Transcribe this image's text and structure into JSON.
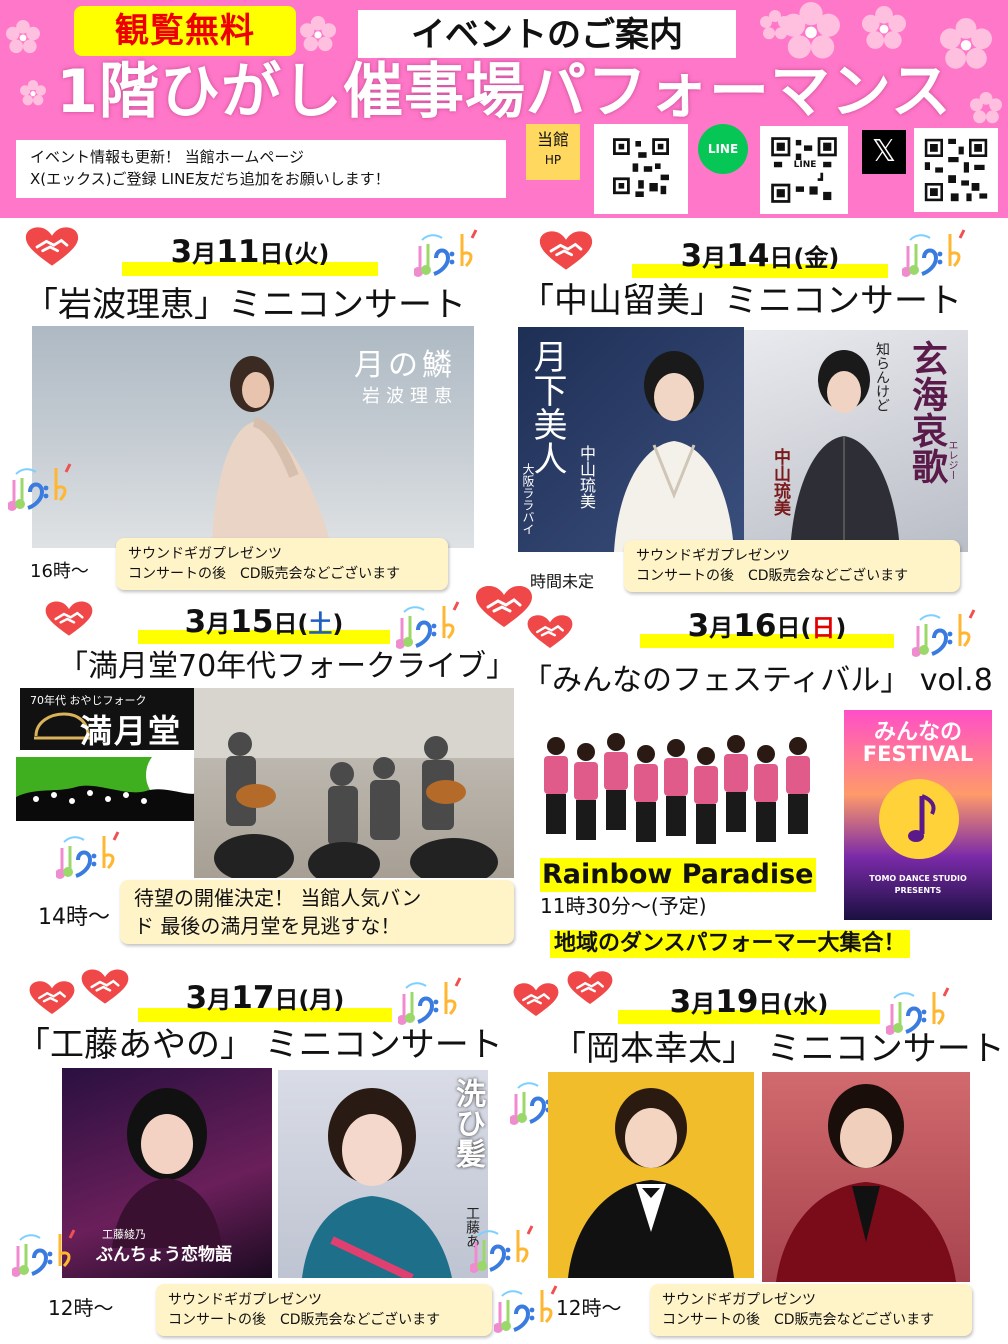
{
  "header": {
    "free_badge": "観覧無料",
    "guide_label": "イベントのご案内",
    "title": "1階ひがし催事場パフォーマンス",
    "info_line1": "イベント情報も更新！ 当館ホームページ",
    "info_line2": "X(エックス)ご登録 LINE友だち追加をお願いします！",
    "hp_badge_line1": "当館",
    "hp_badge_line2": "HP",
    "line_icon_text": "LINE",
    "line_qr_label": "LINE",
    "x_icon_text": "𝕏"
  },
  "events": [
    {
      "date_num1": "3",
      "date_month": "月",
      "date_num2": "11",
      "date_day": "日",
      "dow_open": "(",
      "dow": "火",
      "dow_close": ")",
      "title": "「岩波理恵」ミニコンサート",
      "time": "16時～",
      "note_line1": "サウンドギガプレゼンツ",
      "note_line2": "コンサートの後　CD販売会などございます",
      "cover_text1": "月の鱗",
      "cover_text2": "岩波理恵"
    },
    {
      "date_num1": "3",
      "date_month": "月",
      "date_num2": "14",
      "date_day": "日",
      "dow_open": "(",
      "dow": "金",
      "dow_close": ")",
      "title": "「中山留美」ミニコンサート",
      "time": "時間未定",
      "note_line1": "サウンドギガプレゼンツ",
      "note_line2": "コンサートの後　CD販売会などございます",
      "cover_a_title": "月下美人",
      "cover_a_artist": "中山琉美",
      "cover_a_sub": "大阪ララバイ",
      "cover_b_title": "玄海哀歌",
      "cover_b_ruby": "エレジー",
      "cover_b_sub": "知らんけど",
      "cover_b_artist": "中山琉美"
    },
    {
      "date_num1": "3",
      "date_month": "月",
      "date_num2": "15",
      "date_day": "日",
      "dow_open": "(",
      "dow": "土",
      "dow_close": ")",
      "title": "「満月堂70年代フォークライブ」",
      "time": "14時～",
      "note_line1": "待望の開催決定！ 当館人気バン",
      "note_line2": "ド 最後の満月堂を見逃すな！",
      "logo_small": "70年代 おやじフォーク",
      "logo_big": "満月堂"
    },
    {
      "date_num1": "3",
      "date_month": "月",
      "date_num2": "16",
      "date_day": "日",
      "dow_open": "(",
      "dow": "日",
      "dow_close": ")",
      "title": "「みんなのフェスティバル」 vol.8",
      "group_name": "Rainbow Paradise",
      "time": "11時30分～(予定)",
      "tagline": "地域のダンスパフォーマー大集合！",
      "poster_line1": "みんなの",
      "poster_line2": "FESTIVAL",
      "poster_footer1": "TOMO DANCE STUDIO",
      "poster_footer2": "PRESENTS"
    },
    {
      "date_num1": "3",
      "date_month": "月",
      "date_num2": "17",
      "date_day": "日",
      "dow_open": "(",
      "dow": "月",
      "dow_close": ")",
      "title": "「工藤あやの」 ミニコンサート",
      "time": "12時～",
      "note_line1": "サウンドギガプレゼンツ",
      "note_line2": "コンサートの後　CD販売会などございます",
      "cover_a_title": "ぶんちょう恋物語",
      "cover_a_artist": "工藤綾乃",
      "cover_b_title": "洗ひ髪",
      "cover_b_artist": "工藤あ"
    },
    {
      "date_num1": "3",
      "date_month": "月",
      "date_num2": "19",
      "date_day": "日",
      "dow_open": "(",
      "dow": "水",
      "dow_close": ")",
      "title": "「岡本幸太」 ミニコンサート",
      "time": "12時～",
      "note_line1": "サウンドギガプレゼンツ",
      "note_line2": "コンサートの後　CD販売会などございます"
    }
  ],
  "colors": {
    "header_pink": "#ff77c8",
    "highlight_yellow": "#ffff00",
    "note_bg": "#fff3c8",
    "saturday_blue": "#1f5fbf",
    "sunday_red": "#e00000",
    "line_green": "#06c755"
  }
}
